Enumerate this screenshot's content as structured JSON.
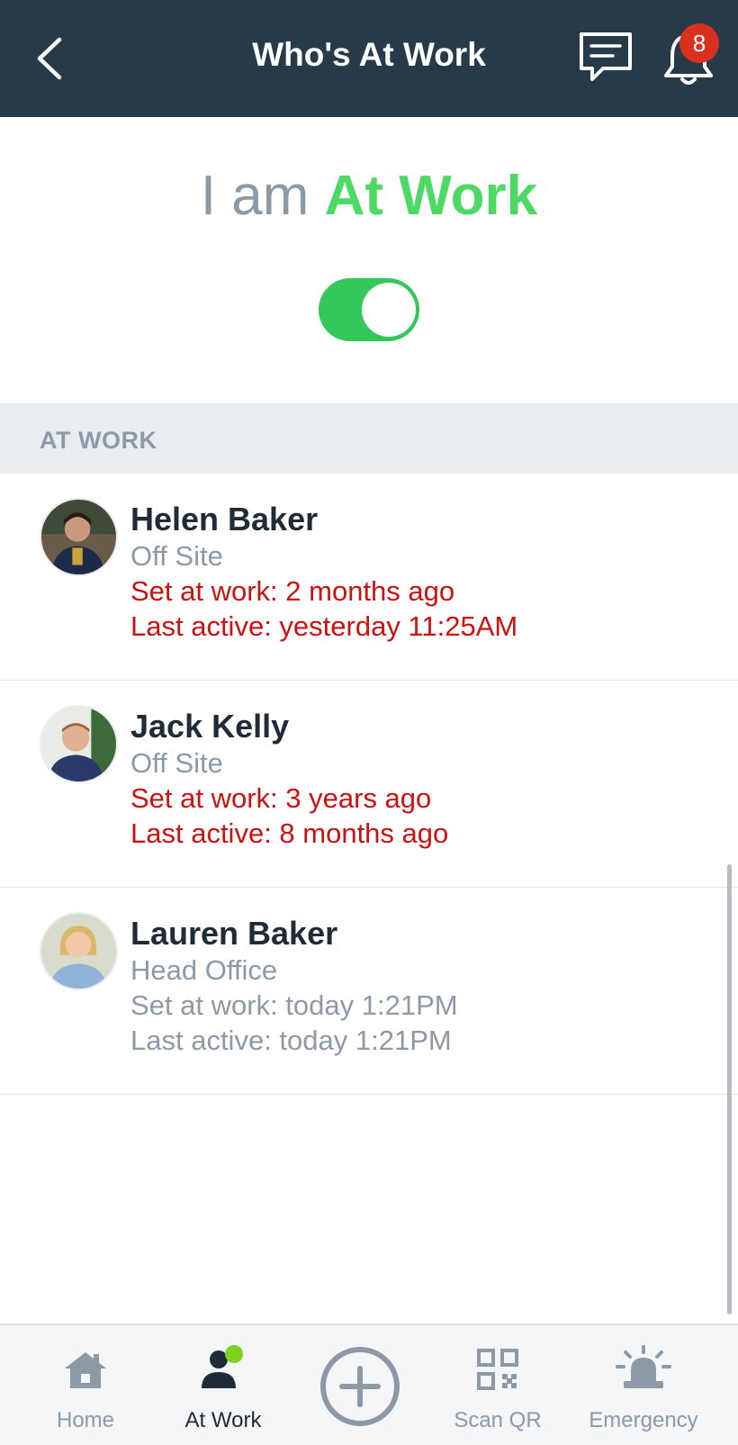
{
  "header": {
    "title": "Who's At Work",
    "notification_count": "8"
  },
  "status": {
    "prefix": "I am",
    "value": "At Work",
    "toggle_on": true
  },
  "section": {
    "title": "AT WORK"
  },
  "people": [
    {
      "name": "Helen Baker",
      "location": "Off Site",
      "set_at_work": "Set at work: 2 months ago",
      "last_active": "Last active: yesterday 11:25AM",
      "status_color": "#cc1111"
    },
    {
      "name": "Jack Kelly",
      "location": "Off Site",
      "set_at_work": "Set at work: 3 years ago",
      "last_active": "Last active: 8 months ago",
      "status_color": "#cc1111"
    },
    {
      "name": "Lauren Baker",
      "location": "Head Office",
      "set_at_work": "Set at work: today 1:21PM",
      "last_active": "Last active: today 1:21PM",
      "status_color": "#8c9aa7"
    }
  ],
  "tabbar": {
    "home": "Home",
    "at_work": "At Work",
    "scan_qr": "Scan QR",
    "emergency": "Emergency"
  },
  "colors": {
    "header_bg": "#263a4a",
    "accent_green": "#4cd964",
    "alert_red": "#cc1111",
    "badge_red": "#d8311f"
  }
}
